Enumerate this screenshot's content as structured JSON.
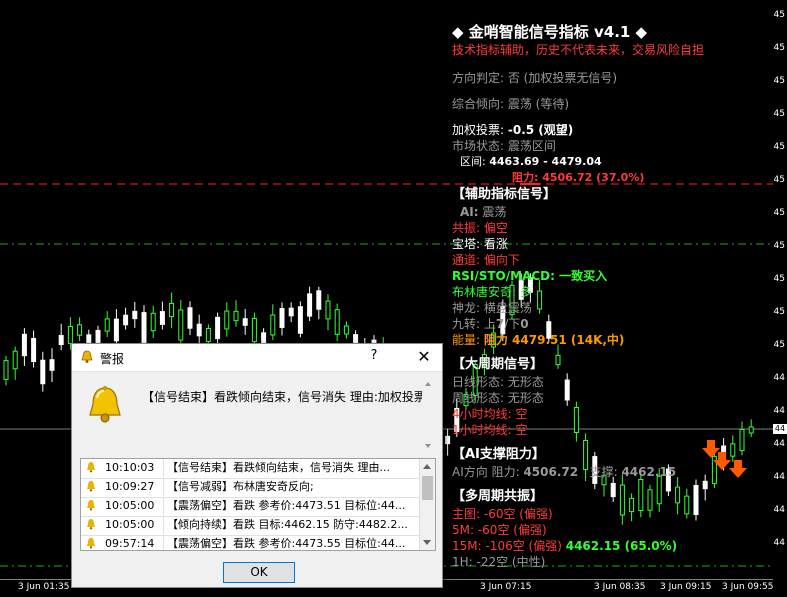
{
  "panel": {
    "title": "◆ 金哨智能信号指标 v4.1 ◆",
    "disclaimer": "技术指标辅助，历史不代表未来，交易风险自担",
    "direction": "方向判定: 否 (加权投票无信号)",
    "tendency": "综合倾向: 震荡 (等待)",
    "vote_label": "加权投票:",
    "vote_value": "-0.5 (观望)",
    "market_state": "市场状态: 震荡区间",
    "range_label": "区间:",
    "range_value": "4463.69 - 4479.04",
    "resistance_line": "阻力: 4506.72 (37.0%)",
    "aux_header": "【辅助指标信号】",
    "ai_label": "AI:",
    "ai_value": "震荡",
    "resonance": "共振: 偏空",
    "baota": "宝塔: 看涨",
    "channel": "通道: 偏向下",
    "rsi": "RSI/STO/MACD: 一致买入",
    "bollinger": "布林唐安奇: 多",
    "shenlong": "神龙: 横盘震荡",
    "nine_turn_label": "九转: 上",
    "nine_turn_up": "7",
    "nine_turn_mid": "/下",
    "nine_turn_down": "0",
    "energy_label": "能量:",
    "energy_value": "阻力 4479.51 (14K,中)",
    "big_header": "【大周期信号】",
    "daily": "日线形态: 无形态",
    "weekly": "周线形态: 无形态",
    "h4": "4小时均线: 空",
    "h1": "1小时均线: 空",
    "ai_sr_header": "【AI支撑阻力】",
    "ai_dir": "AI方向",
    "ai_res_label": "阻力:",
    "ai_res_value": "4506.72",
    "ai_sup_label": "支撑:",
    "ai_sup_value": "4462.15",
    "multi_header": "【多周期共振】",
    "main_chart": "主图: -60空 (偏强)",
    "m5": "5M: -60空 (偏强)",
    "m15": "15M: -106空 (偏强)",
    "support_line": "4462.15 (65.0%)",
    "h1_res": "1H: -22空 (中性)"
  },
  "axis": {
    "y_ticks": [
      "45",
      "45",
      "45",
      "45",
      "45",
      "45",
      "45",
      "45",
      "45",
      "45",
      "45",
      "44",
      "44",
      "44",
      "44",
      "44",
      "44"
    ],
    "current_price": "44",
    "x_ticks": [
      "3 Jun 01:35",
      "3 Jun 07:15",
      "3 Jun 08:35",
      "3 Jun 09:15",
      "3 Jun 09:55"
    ]
  },
  "colors": {
    "bull": "#33ff33",
    "bear": "#ffffff",
    "resistance": "#ff2020",
    "support": "#1fa81f",
    "arrow": "#ff5a00"
  },
  "dialog": {
    "title": "警报",
    "help": "?",
    "close": "✕",
    "message": "【信号结束】看跌倾向结束，信号消失 理由:加权投票",
    "ok": "OK",
    "rows": [
      {
        "time": "10:10:03",
        "msg": "【信号结束】看跌倾向结束，信号消失 理由..."
      },
      {
        "time": "10:09:27",
        "msg": "【信号减弱】布林唐安奇反向;"
      },
      {
        "time": "10:05:00",
        "msg": "【震荡偏空】看跌 参考价:4473.51 目标位:44..."
      },
      {
        "time": "10:05:00",
        "msg": "【倾向持续】看跌 目标:4462.15 防守:4482.2..."
      },
      {
        "time": "09:57:14",
        "msg": "【震荡偏空】看跌 参考价:4473.55 目标位:44..."
      }
    ]
  }
}
